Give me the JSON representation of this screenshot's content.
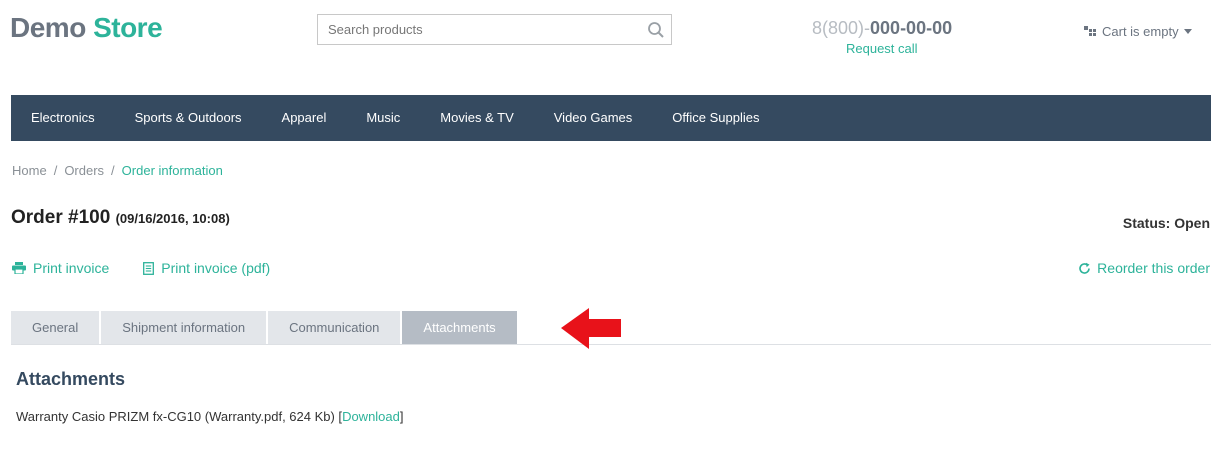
{
  "header": {
    "logo_part1": "Demo",
    "logo_part2": "Store",
    "search_placeholder": "Search products",
    "search_icon": "search-icon",
    "phone_prefix": "8(800)-",
    "phone_number": "000-00-00",
    "request_call": "Request call",
    "cart_label": "Cart is empty",
    "cart_icon": "cart-icon"
  },
  "nav": {
    "items": [
      "Electronics",
      "Sports & Outdoors",
      "Apparel",
      "Music",
      "Movies & TV",
      "Video Games",
      "Office Supplies"
    ]
  },
  "breadcrumb": {
    "items": [
      "Home",
      "Orders",
      "Order information"
    ],
    "separator": "/"
  },
  "order": {
    "title": "Order #100",
    "date": "(09/16/2016, 10:08)",
    "status": "Status: Open",
    "print_invoice": "Print invoice",
    "print_invoice_pdf": "Print invoice (pdf)",
    "reorder": "Reorder this order"
  },
  "tabs": {
    "items": [
      "General",
      "Shipment information",
      "Communication",
      "Attachments"
    ],
    "active": "Attachments"
  },
  "attachments": {
    "heading": "Attachments",
    "file_description": "Warranty Casio PRIZM fx-CG10 (Warranty.pdf, 624 Kb) [",
    "download_label": "Download",
    "close_bracket": "]"
  },
  "colors": {
    "accent": "#2db39a",
    "nav_bg": "#354a60",
    "tab_active_bg": "#b5bcc5",
    "tab_bg": "#e3e6ea",
    "annotation_arrow": "#e8121a"
  }
}
